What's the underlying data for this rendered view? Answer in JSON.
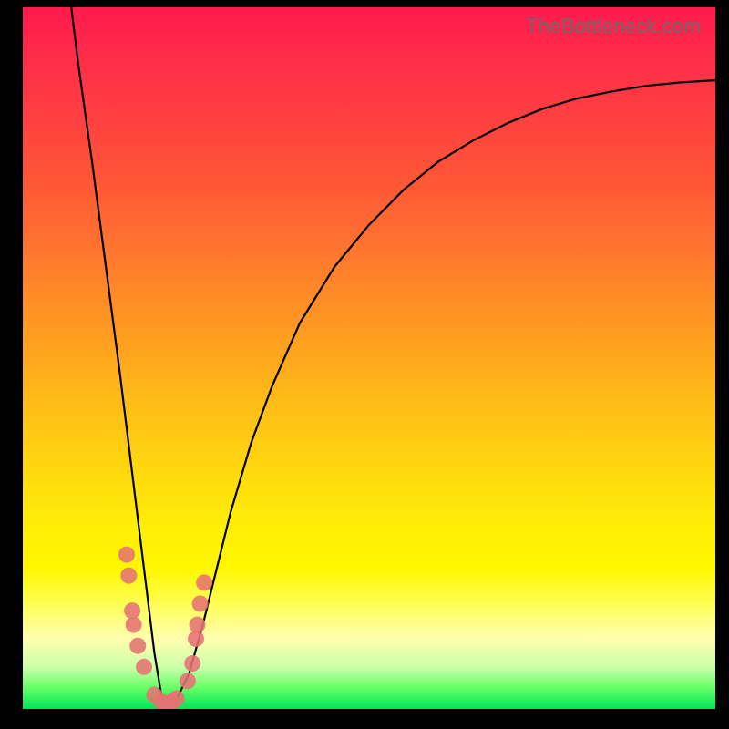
{
  "watermark": "TheBottleneck.com",
  "colors": {
    "frame": "#000000",
    "curve": "#000000",
    "dots": "#e57373",
    "gradient_top": "#ff1a4d",
    "gradient_bottom": "#00e65a"
  },
  "chart_data": {
    "type": "line",
    "title": "",
    "xlabel": "",
    "ylabel": "",
    "xlim": [
      0,
      100
    ],
    "ylim": [
      0,
      100
    ],
    "note": "No axes, ticks, or numeric labels are rendered in the image. x/y values are estimated from pixel positions (0-100 normalized). y=0 is at the bottom (green), y=100 at the top (red).",
    "series": [
      {
        "name": "curve",
        "x": [
          7,
          8,
          10,
          12,
          14,
          15,
          16,
          17,
          18,
          19,
          20,
          21,
          22,
          24,
          26,
          28,
          30,
          33,
          36,
          40,
          45,
          50,
          55,
          60,
          65,
          70,
          75,
          80,
          85,
          90,
          95,
          100
        ],
        "y": [
          100,
          92,
          78,
          63,
          48,
          40,
          32,
          24,
          16,
          8,
          2,
          0,
          1,
          5,
          12,
          20,
          28,
          38,
          46,
          55,
          63,
          69,
          74,
          78,
          81,
          83.5,
          85.5,
          87,
          88,
          88.8,
          89.3,
          89.6
        ]
      }
    ],
    "points": [
      {
        "x": 15.0,
        "y": 22
      },
      {
        "x": 15.3,
        "y": 19
      },
      {
        "x": 15.8,
        "y": 14
      },
      {
        "x": 16.0,
        "y": 12
      },
      {
        "x": 16.6,
        "y": 9
      },
      {
        "x": 17.5,
        "y": 6
      },
      {
        "x": 19.0,
        "y": 2
      },
      {
        "x": 20.0,
        "y": 1
      },
      {
        "x": 20.8,
        "y": 0.8
      },
      {
        "x": 21.5,
        "y": 1
      },
      {
        "x": 22.2,
        "y": 1.5
      },
      {
        "x": 23.8,
        "y": 4
      },
      {
        "x": 24.5,
        "y": 6.5
      },
      {
        "x": 25.0,
        "y": 10
      },
      {
        "x": 25.2,
        "y": 12
      },
      {
        "x": 25.6,
        "y": 15
      },
      {
        "x": 26.2,
        "y": 18
      }
    ]
  }
}
